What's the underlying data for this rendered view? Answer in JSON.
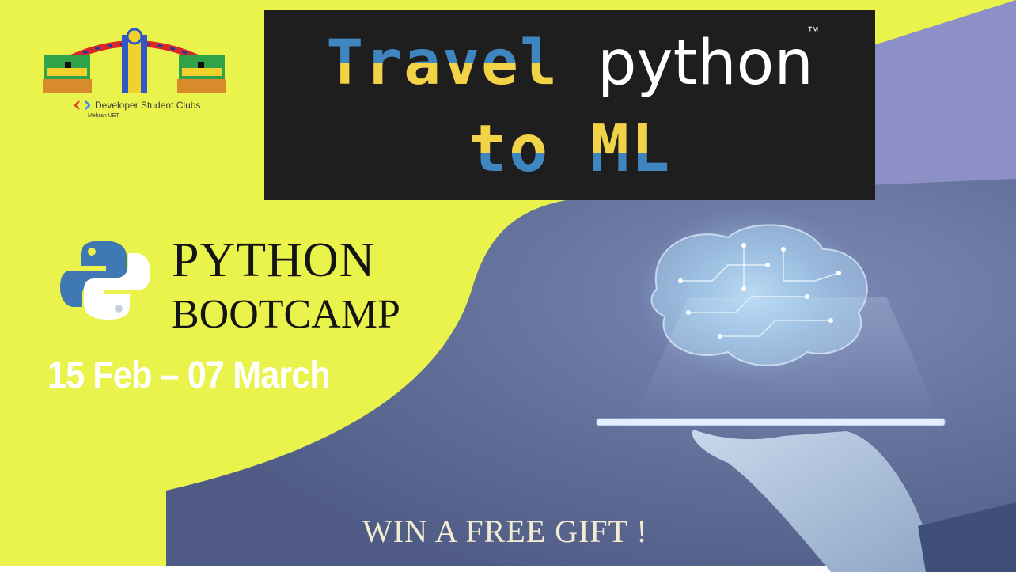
{
  "colors": {
    "lime": "#e9f34b",
    "lavender": "#8c90c6",
    "slate": "#5f6d96",
    "title_bg": "#1e1e1e",
    "python_blue": "#3f78b3",
    "python_yellow": "#ffffff",
    "accent_yellow": "#f2d246"
  },
  "title": {
    "line1_word1": "Travel",
    "line1_word2": "python",
    "trademark": "™",
    "line2": "to ML"
  },
  "club": {
    "name": "Developer Student Clubs",
    "sub": "Mehran UET",
    "icon": "code-brackets-icon"
  },
  "event": {
    "heading_line1": "PYTHON",
    "heading_line2": "BOOTCAMP",
    "dates": "15 Feb – 07 March",
    "promo": "WIN A FREE GIFT !"
  },
  "icons": {
    "python": "python-logo-icon",
    "brain": "brain-circuit-icon",
    "tablet_hand": "hand-holding-tablet-icon",
    "university_gate": "university-gate-icon"
  }
}
